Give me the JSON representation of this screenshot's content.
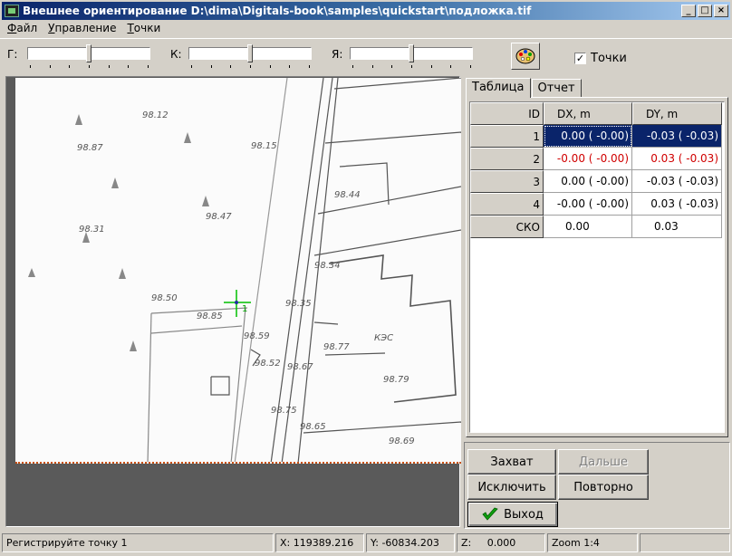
{
  "window": {
    "title": "Внешнее ориентирование D:\\dima\\Digitals-book\\samples\\quickstart\\подложка.tif",
    "min_label": "_",
    "max_label": "□",
    "close_label": "×"
  },
  "menu": {
    "items": [
      {
        "first": "Ф",
        "rest": "айл"
      },
      {
        "first": "У",
        "rest": "правление"
      },
      {
        "first": "Т",
        "rest": "очки"
      }
    ]
  },
  "toolbar": {
    "sliders": [
      {
        "label": "Г:",
        "value": 0.5
      },
      {
        "label": "К:",
        "value": 0.5
      },
      {
        "label": "Я:",
        "value": 0.5
      }
    ],
    "palette_icon": "palette-icon",
    "points_checkbox": {
      "label": "Точки",
      "checked": true,
      "mark": "✓"
    }
  },
  "image": {
    "marker_label": "1",
    "map_labels": [
      "98.12",
      "98.87",
      "98.31",
      "98.47",
      "98.15",
      "98.44",
      "98.34",
      "98.35",
      "98.77",
      "98.67",
      "98.79",
      "98.65",
      "98.69",
      "98.50",
      "98.59",
      "98.52",
      "98.75",
      "98.85",
      "КЭС"
    ]
  },
  "tabs": {
    "items": [
      "Таблица",
      "Отчет"
    ],
    "active": 0
  },
  "table": {
    "headers": [
      "ID",
      "DX, m",
      "DY, m"
    ],
    "rows": [
      {
        "id": "1",
        "dx": "0.00 ( -0.00)",
        "dy": "-0.03 ( -0.03)",
        "selected": true,
        "excluded": false
      },
      {
        "id": "2",
        "dx": "-0.00 ( -0.00)",
        "dy": "0.03 ( -0.03)",
        "selected": false,
        "excluded": true
      },
      {
        "id": "3",
        "dx": "0.00 ( -0.00)",
        "dy": "-0.03 ( -0.03)",
        "selected": false,
        "excluded": false
      },
      {
        "id": "4",
        "dx": "-0.00 ( -0.00)",
        "dy": "0.03 ( -0.03)",
        "selected": false,
        "excluded": false
      }
    ],
    "summary": {
      "id": "СКО",
      "dx": "0.00",
      "dy": "0.03"
    }
  },
  "buttons": {
    "capture": "Захват",
    "next": "Дальше",
    "exclude": "Исключить",
    "repeat": "Повторно",
    "exit": "Выход",
    "exit_icon": "checkmark-icon"
  },
  "status": {
    "message": "Регистрируйте точку 1",
    "x": "X: 119389.216",
    "y": "Y: -60834.203",
    "z_label": "Z:",
    "z_value": "0.000",
    "zoom": "Zoom 1:4"
  },
  "colors": {
    "selection": "#0a246a",
    "excluded": "#d00000",
    "marker": "#00c000",
    "titlebar": "#0a246a"
  }
}
